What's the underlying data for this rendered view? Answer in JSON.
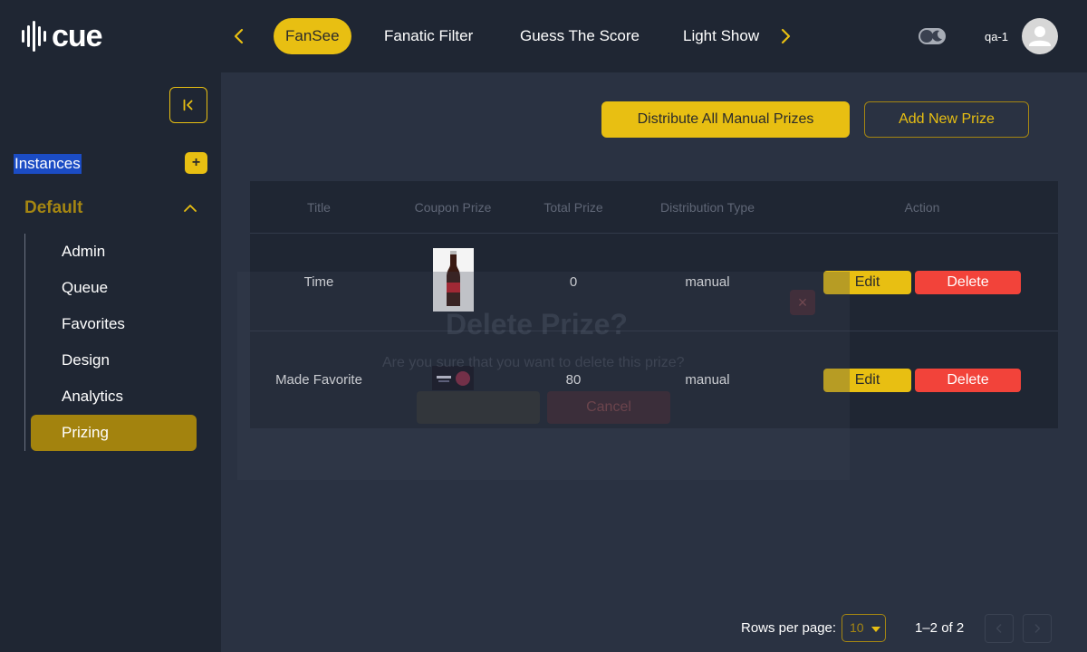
{
  "header": {
    "logo_text": "cue",
    "tabs": [
      "FanSee",
      "Fanatic Filter",
      "Guess The Score",
      "Light Show"
    ],
    "active_tab": "FanSee",
    "username": "qa-1"
  },
  "sidebar": {
    "instances_label": "Instances",
    "add_label": "+",
    "group_label": "Default",
    "items": [
      "Admin",
      "Queue",
      "Favorites",
      "Design",
      "Analytics",
      "Prizing"
    ],
    "active_item": "Prizing"
  },
  "actions": {
    "distribute_label": "Distribute All Manual Prizes",
    "add_label": "Add New Prize"
  },
  "table": {
    "headers": [
      "Title",
      "Coupon Prize",
      "Total Prize",
      "Distribution Type",
      "Action"
    ],
    "rows": [
      {
        "title": "Time",
        "coupon_image": "coca-cola bottle",
        "total_prize": "0",
        "distribution_type": "manual",
        "edit_label": "Edit",
        "delete_label": "Delete"
      },
      {
        "title": "Made Favorite",
        "coupon_image": "promo banner",
        "total_prize": "80",
        "distribution_type": "manual",
        "edit_label": "Edit",
        "delete_label": "Delete"
      }
    ]
  },
  "dialog": {
    "title": "Delete Prize?",
    "message": "Are you sure that you want to delete this prize?",
    "close_label": "×",
    "cancel_label": "Cancel"
  },
  "pagination": {
    "rows_per_page_label": "Rows per page:",
    "rows_per_page_value": "10",
    "range_text": "1–2 of 2"
  },
  "colors": {
    "accent": "#e8bf12",
    "danger": "#f2433a",
    "surface": "#1f2633",
    "background": "#2a3242",
    "active_nav": "#a3830e"
  }
}
